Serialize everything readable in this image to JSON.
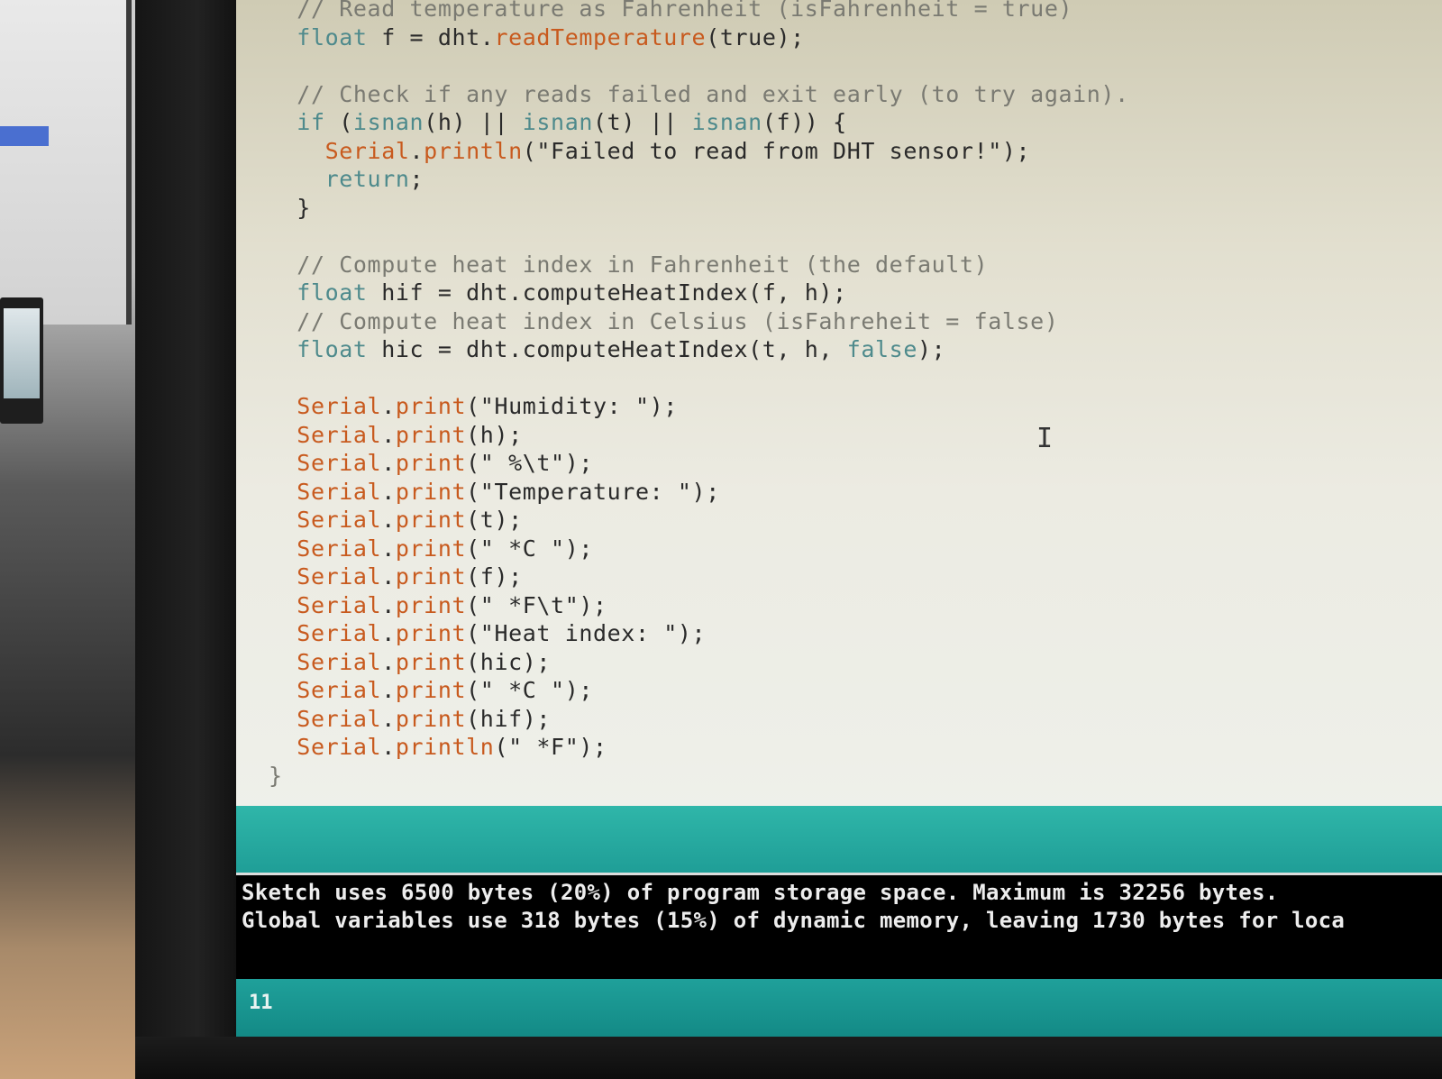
{
  "editor": {
    "lines": [
      {
        "parts": [
          {
            "c": "cm",
            "t": "  // Read temperature as Fahrenheit (isFahrenheit = true)"
          }
        ]
      },
      {
        "parts": [
          {
            "c": "kw",
            "t": "  float"
          },
          {
            "c": "tx",
            "t": " f = dht."
          },
          {
            "c": "fn",
            "t": "readTemperature"
          },
          {
            "c": "tx",
            "t": "(true);"
          }
        ]
      },
      {
        "parts": [
          {
            "c": "tx",
            "t": ""
          }
        ]
      },
      {
        "parts": [
          {
            "c": "cm",
            "t": "  // Check if any reads failed and exit early (to try again)."
          }
        ]
      },
      {
        "parts": [
          {
            "c": "kw",
            "t": "  if"
          },
          {
            "c": "tx",
            "t": " ("
          },
          {
            "c": "kw",
            "t": "isnan"
          },
          {
            "c": "tx",
            "t": "(h) || "
          },
          {
            "c": "kw",
            "t": "isnan"
          },
          {
            "c": "tx",
            "t": "(t) || "
          },
          {
            "c": "kw",
            "t": "isnan"
          },
          {
            "c": "tx",
            "t": "(f)) {"
          }
        ]
      },
      {
        "parts": [
          {
            "c": "fn",
            "t": "    Serial"
          },
          {
            "c": "tx",
            "t": "."
          },
          {
            "c": "fn",
            "t": "println"
          },
          {
            "c": "tx",
            "t": "(\"Failed to read from DHT sensor!\");"
          }
        ]
      },
      {
        "parts": [
          {
            "c": "kw",
            "t": "    return"
          },
          {
            "c": "tx",
            "t": ";"
          }
        ]
      },
      {
        "parts": [
          {
            "c": "tx",
            "t": "  }"
          }
        ]
      },
      {
        "parts": [
          {
            "c": "tx",
            "t": ""
          }
        ]
      },
      {
        "parts": [
          {
            "c": "cm",
            "t": "  // Compute heat index in Fahrenheit (the default)"
          }
        ]
      },
      {
        "parts": [
          {
            "c": "kw",
            "t": "  float"
          },
          {
            "c": "tx",
            "t": " hif = dht.computeHeatIndex(f, h);"
          }
        ]
      },
      {
        "parts": [
          {
            "c": "cm",
            "t": "  // Compute heat index in Celsius (isFahreheit = false)"
          }
        ]
      },
      {
        "parts": [
          {
            "c": "kw",
            "t": "  float"
          },
          {
            "c": "tx",
            "t": " hic = dht.computeHeatIndex(t, h, "
          },
          {
            "c": "kw",
            "t": "false"
          },
          {
            "c": "tx",
            "t": ");"
          }
        ]
      },
      {
        "parts": [
          {
            "c": "tx",
            "t": ""
          }
        ]
      },
      {
        "parts": [
          {
            "c": "fn",
            "t": "  Serial"
          },
          {
            "c": "tx",
            "t": "."
          },
          {
            "c": "fn",
            "t": "print"
          },
          {
            "c": "tx",
            "t": "(\"Humidity: \");"
          }
        ]
      },
      {
        "parts": [
          {
            "c": "fn",
            "t": "  Serial"
          },
          {
            "c": "tx",
            "t": "."
          },
          {
            "c": "fn",
            "t": "print"
          },
          {
            "c": "tx",
            "t": "(h);"
          }
        ]
      },
      {
        "parts": [
          {
            "c": "fn",
            "t": "  Serial"
          },
          {
            "c": "tx",
            "t": "."
          },
          {
            "c": "fn",
            "t": "print"
          },
          {
            "c": "tx",
            "t": "(\" %\\t\");"
          }
        ]
      },
      {
        "parts": [
          {
            "c": "fn",
            "t": "  Serial"
          },
          {
            "c": "tx",
            "t": "."
          },
          {
            "c": "fn",
            "t": "print"
          },
          {
            "c": "tx",
            "t": "(\"Temperature: \");"
          }
        ]
      },
      {
        "parts": [
          {
            "c": "fn",
            "t": "  Serial"
          },
          {
            "c": "tx",
            "t": "."
          },
          {
            "c": "fn",
            "t": "print"
          },
          {
            "c": "tx",
            "t": "(t);"
          }
        ]
      },
      {
        "parts": [
          {
            "c": "fn",
            "t": "  Serial"
          },
          {
            "c": "tx",
            "t": "."
          },
          {
            "c": "fn",
            "t": "print"
          },
          {
            "c": "tx",
            "t": "(\" *C \");"
          }
        ]
      },
      {
        "parts": [
          {
            "c": "fn",
            "t": "  Serial"
          },
          {
            "c": "tx",
            "t": "."
          },
          {
            "c": "fn",
            "t": "print"
          },
          {
            "c": "tx",
            "t": "(f);"
          }
        ]
      },
      {
        "parts": [
          {
            "c": "fn",
            "t": "  Serial"
          },
          {
            "c": "tx",
            "t": "."
          },
          {
            "c": "fn",
            "t": "print"
          },
          {
            "c": "tx",
            "t": "(\" *F\\t\");"
          }
        ]
      },
      {
        "parts": [
          {
            "c": "fn",
            "t": "  Serial"
          },
          {
            "c": "tx",
            "t": "."
          },
          {
            "c": "fn",
            "t": "print"
          },
          {
            "c": "tx",
            "t": "(\"Heat index: \");"
          }
        ]
      },
      {
        "parts": [
          {
            "c": "fn",
            "t": "  Serial"
          },
          {
            "c": "tx",
            "t": "."
          },
          {
            "c": "fn",
            "t": "print"
          },
          {
            "c": "tx",
            "t": "(hic);"
          }
        ]
      },
      {
        "parts": [
          {
            "c": "fn",
            "t": "  Serial"
          },
          {
            "c": "tx",
            "t": "."
          },
          {
            "c": "fn",
            "t": "print"
          },
          {
            "c": "tx",
            "t": "(\" *C \");"
          }
        ]
      },
      {
        "parts": [
          {
            "c": "fn",
            "t": "  Serial"
          },
          {
            "c": "tx",
            "t": "."
          },
          {
            "c": "fn",
            "t": "print"
          },
          {
            "c": "tx",
            "t": "(hif);"
          }
        ]
      },
      {
        "parts": [
          {
            "c": "fn",
            "t": "  Serial"
          },
          {
            "c": "tx",
            "t": "."
          },
          {
            "c": "fn",
            "t": "println"
          },
          {
            "c": "tx",
            "t": "(\" *F\");"
          }
        ]
      },
      {
        "parts": [
          {
            "c": "cm",
            "t": "}"
          }
        ]
      }
    ]
  },
  "console": {
    "line1": "Sketch uses 6500 bytes (20%) of program storage space. Maximum is 32256 bytes.",
    "line2": "Global variables use 318 bytes (15%) of dynamic memory, leaving 1730 bytes for loca"
  },
  "status": {
    "line_number": "11"
  },
  "colors": {
    "accent": "#1f9e97",
    "keyword": "#4e8a8c",
    "function": "#c85a1e",
    "comment": "#7a7a72"
  },
  "icons": {
    "text_cursor": "i-beam-cursor-icon"
  }
}
